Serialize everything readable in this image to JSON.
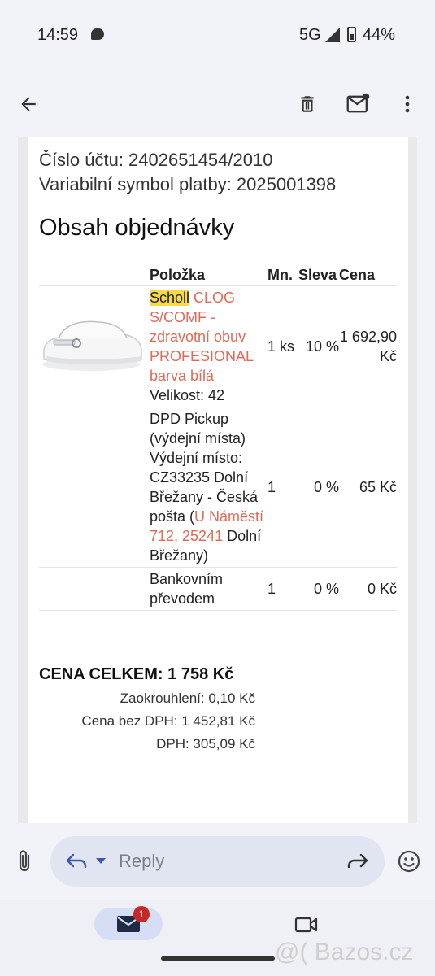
{
  "status": {
    "time": "14:59",
    "network": "5G",
    "battery": "44%"
  },
  "email": {
    "account_line": "Číslo účtu: 2402651454/2010",
    "variable_symbol_line": "Variabilní symbol platby: 2025001398",
    "section_title": "Obsah objednávky",
    "table": {
      "headers": {
        "item": "Položka",
        "qty": "Mn.",
        "discount": "Sleva",
        "price": "Cena"
      },
      "rows": [
        {
          "brand": "Scholl",
          "name": " CLOG S/COMF - zdravotní obuv PROFESIONAL barva bílá",
          "size": "Velikost: 42",
          "qty": "1 ks",
          "discount": "10 %",
          "price": "1 692,90 Kč"
        },
        {
          "name_part1": "DPD Pickup (výdejní místa) Výdejní místo: CZ33235 Dolní Břežany - Česká pošta (",
          "address_link": "U Náměstí 712, 25241",
          "name_part2": " Dolní Břežany)",
          "qty": "1",
          "discount": "0 %",
          "price": "65 Kč"
        },
        {
          "name": "Bankovním převodem",
          "qty": "1",
          "discount": "0 %",
          "price": "0 Kč"
        }
      ]
    },
    "totals": {
      "total": "CENA CELKEM: 1 758 Kč",
      "rounding": "Zaokrouhlení: 0,10 Kč",
      "without_vat": "Cena bez DPH: 1 452,81 Kč",
      "vat": "DPH: 305,09 Kč"
    }
  },
  "reply": {
    "placeholder": "Reply"
  },
  "nav": {
    "mail_badge": "1"
  },
  "watermark": "@( Bazos.cz",
  "colors": {
    "link": "#e06a56",
    "highlight": "#f8d94a",
    "accent": "#d6def6"
  }
}
